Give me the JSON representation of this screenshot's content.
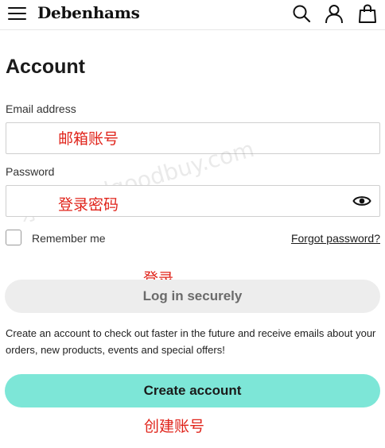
{
  "header": {
    "brand": "Debenhams",
    "icons": [
      "menu-icon",
      "search-icon",
      "account-icon",
      "bag-icon"
    ]
  },
  "page": {
    "title": "Account"
  },
  "form": {
    "email_label": "Email address",
    "email_value": "",
    "password_label": "Password",
    "password_value": "",
    "remember_label": "Remember me",
    "forgot_link": "Forgot password?",
    "login_button": "Log in securely",
    "info_text": "Create an account to check out faster in the future and receive emails about your orders, new products, events and special offers!",
    "create_button": "Create account"
  },
  "annotations": {
    "email": "邮箱账号",
    "password": "登录密码",
    "login": "登录",
    "create": "创建账号"
  },
  "watermark": "乐淘网 olgoodbuy.com",
  "colors": {
    "accent": "#7de6d7",
    "annotation": "#e0241b",
    "login_button_bg": "#ededed"
  }
}
